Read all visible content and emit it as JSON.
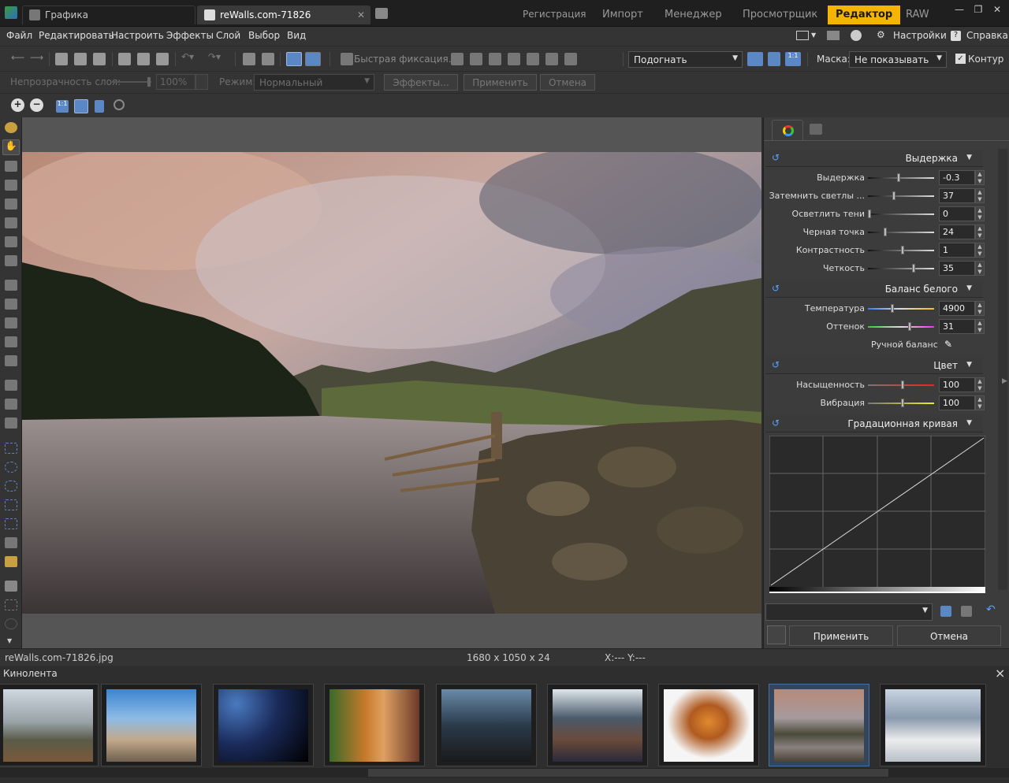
{
  "titlebar": {
    "tabs": [
      {
        "label": "Графика",
        "active": false
      },
      {
        "label": "reWalls.com-71826",
        "active": true
      }
    ],
    "modes": [
      "Регистрация",
      "Импорт",
      "Менеджер",
      "Просмотрщик",
      "Редактор",
      "RAW"
    ],
    "active_mode": "Редактор"
  },
  "menubar": {
    "items": [
      "Файл",
      "Редактировать",
      "Настроить",
      "Эффекты",
      "Слой",
      "Выбор",
      "Вид"
    ],
    "settings_label": "Настройки",
    "help_label": "Справка"
  },
  "toolbar": {
    "quick_fix_label": "Быстрая фиксация...",
    "fit_select": "Подогнать",
    "mask_label": "Маска:",
    "mask_select": "Не показывать",
    "contour_label": "Контур",
    "contour_checked": true
  },
  "layerbar": {
    "opacity_label": "Непрозрачность слоя:",
    "opacity_value": "100%",
    "mode_label": "Режим:",
    "mode_value": "Нормальный",
    "effects_btn": "Эффекты...",
    "apply_btn": "Применить",
    "cancel_btn": "Отмена"
  },
  "panel": {
    "exposure": {
      "title": "Выдержка",
      "rows": [
        {
          "label": "Выдержка",
          "value": "-0.3"
        },
        {
          "label": "Затемнить светлы ...",
          "value": "37"
        },
        {
          "label": "Осветлить тени",
          "value": "0"
        },
        {
          "label": "Черная точка",
          "value": "24"
        },
        {
          "label": "Контрастность",
          "value": "1"
        },
        {
          "label": "Четкость",
          "value": "35"
        }
      ]
    },
    "white_balance": {
      "title": "Баланс белого",
      "rows": [
        {
          "label": "Температура",
          "value": "4900"
        },
        {
          "label": "Оттенок",
          "value": "31"
        }
      ],
      "manual_label": "Ручной баланс"
    },
    "color": {
      "title": "Цвет",
      "rows": [
        {
          "label": "Насыщенность",
          "value": "100"
        },
        {
          "label": "Вибрация",
          "value": "100"
        }
      ]
    },
    "curve": {
      "title": "Градационная кривая"
    },
    "apply_btn": "Применить",
    "cancel_btn": "Отмена"
  },
  "status": {
    "filename": "reWalls.com-71826.jpg",
    "dimensions": "1680 x 1050 x 24",
    "coords": "X:---  Y:---"
  },
  "filmstrip": {
    "title": "Кинолента",
    "close": "×"
  },
  "colors": {
    "accent": "#f4b400",
    "background": "#343434",
    "selected_thumb": "#34455e"
  }
}
